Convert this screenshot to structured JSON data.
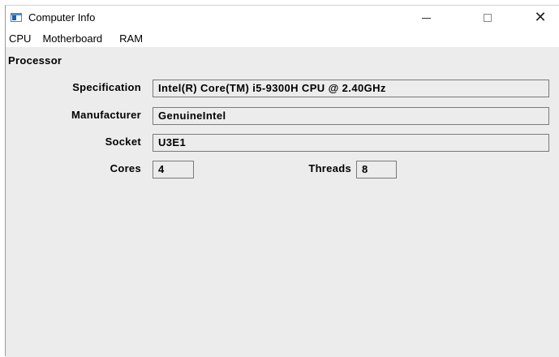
{
  "window": {
    "title": "Computer Info",
    "minimize_symbol": "",
    "maximize_symbol": "",
    "close_symbol": "✕"
  },
  "menu": {
    "items": [
      {
        "label": "CPU"
      },
      {
        "label": "Motherboard"
      },
      {
        "label": "RAM"
      }
    ]
  },
  "section": {
    "title": "Processor"
  },
  "fields": {
    "specification": {
      "label": "Specification",
      "value": "Intel(R) Core(TM) i5-9300H CPU @ 2.40GHz"
    },
    "manufacturer": {
      "label": "Manufacturer",
      "value": "GenuineIntel"
    },
    "socket": {
      "label": "Socket",
      "value": "U3E1"
    },
    "cores": {
      "label": "Cores",
      "value": "4"
    },
    "threads": {
      "label": "Threads",
      "value": "8"
    }
  }
}
